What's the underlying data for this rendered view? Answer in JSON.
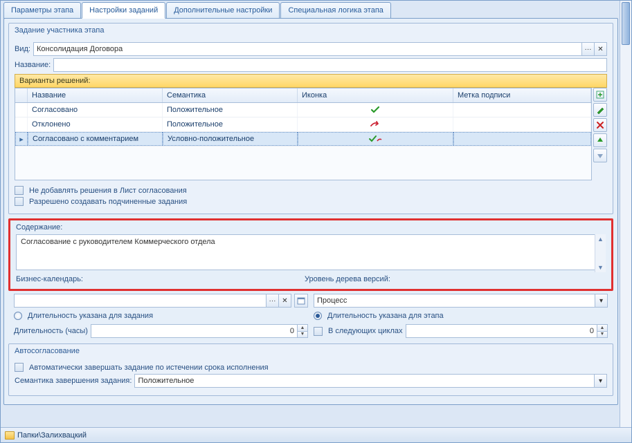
{
  "tabs": {
    "t0": "Параметры этапа",
    "t1": "Настройки заданий",
    "t2": "Дополнительные настройки",
    "t3": "Специальная логика этапа",
    "active": 1
  },
  "group_task": {
    "title": "Задание участника этапа",
    "kind_label": "Вид:",
    "kind_value": "Консолидация Договора",
    "name_label": "Название:",
    "name_value": ""
  },
  "variants": {
    "title": "Варианты решений:",
    "columns": {
      "name": "Название",
      "sem": "Семантика",
      "icon": "Иконка",
      "mark": "Метка подписи"
    },
    "rows": [
      {
        "name": "Согласовано",
        "sem": "Положительное",
        "icon": "check-green"
      },
      {
        "name": "Отклонено",
        "sem": "Положительное",
        "icon": "arrow-red"
      },
      {
        "name": "Согласовано с комментарием",
        "sem": "Условно-положительное",
        "icon": "check-arrow"
      }
    ]
  },
  "checks": {
    "no_add": "Не добавлять решения в Лист согласования",
    "allow_sub": "Разрешено создавать подчиненные задания"
  },
  "content": {
    "label": "Содержание:",
    "value": "Согласование с руководителем Коммерческого отдела",
    "biz_cal": "Бизнес-календарь:",
    "ver_tree": "Уровень дерева версий:"
  },
  "process": {
    "value": "Процесс"
  },
  "duration_radios": {
    "r0": "Длительность указана для задания",
    "r1": "Длительность указана для этапа"
  },
  "duration": {
    "label": "Длительность (часы)",
    "value": "0",
    "cycles_label": "В следующих циклах",
    "cycles_value": "0"
  },
  "autoapprove": {
    "title": "Автосогласование",
    "auto_label": "Автоматически завершать задание по истечении срока исполнения",
    "sem_label": "Семантика завершения задания:",
    "sem_value": "Положительное"
  },
  "statusbar": {
    "path": "Папки\\Залихвацкий"
  }
}
